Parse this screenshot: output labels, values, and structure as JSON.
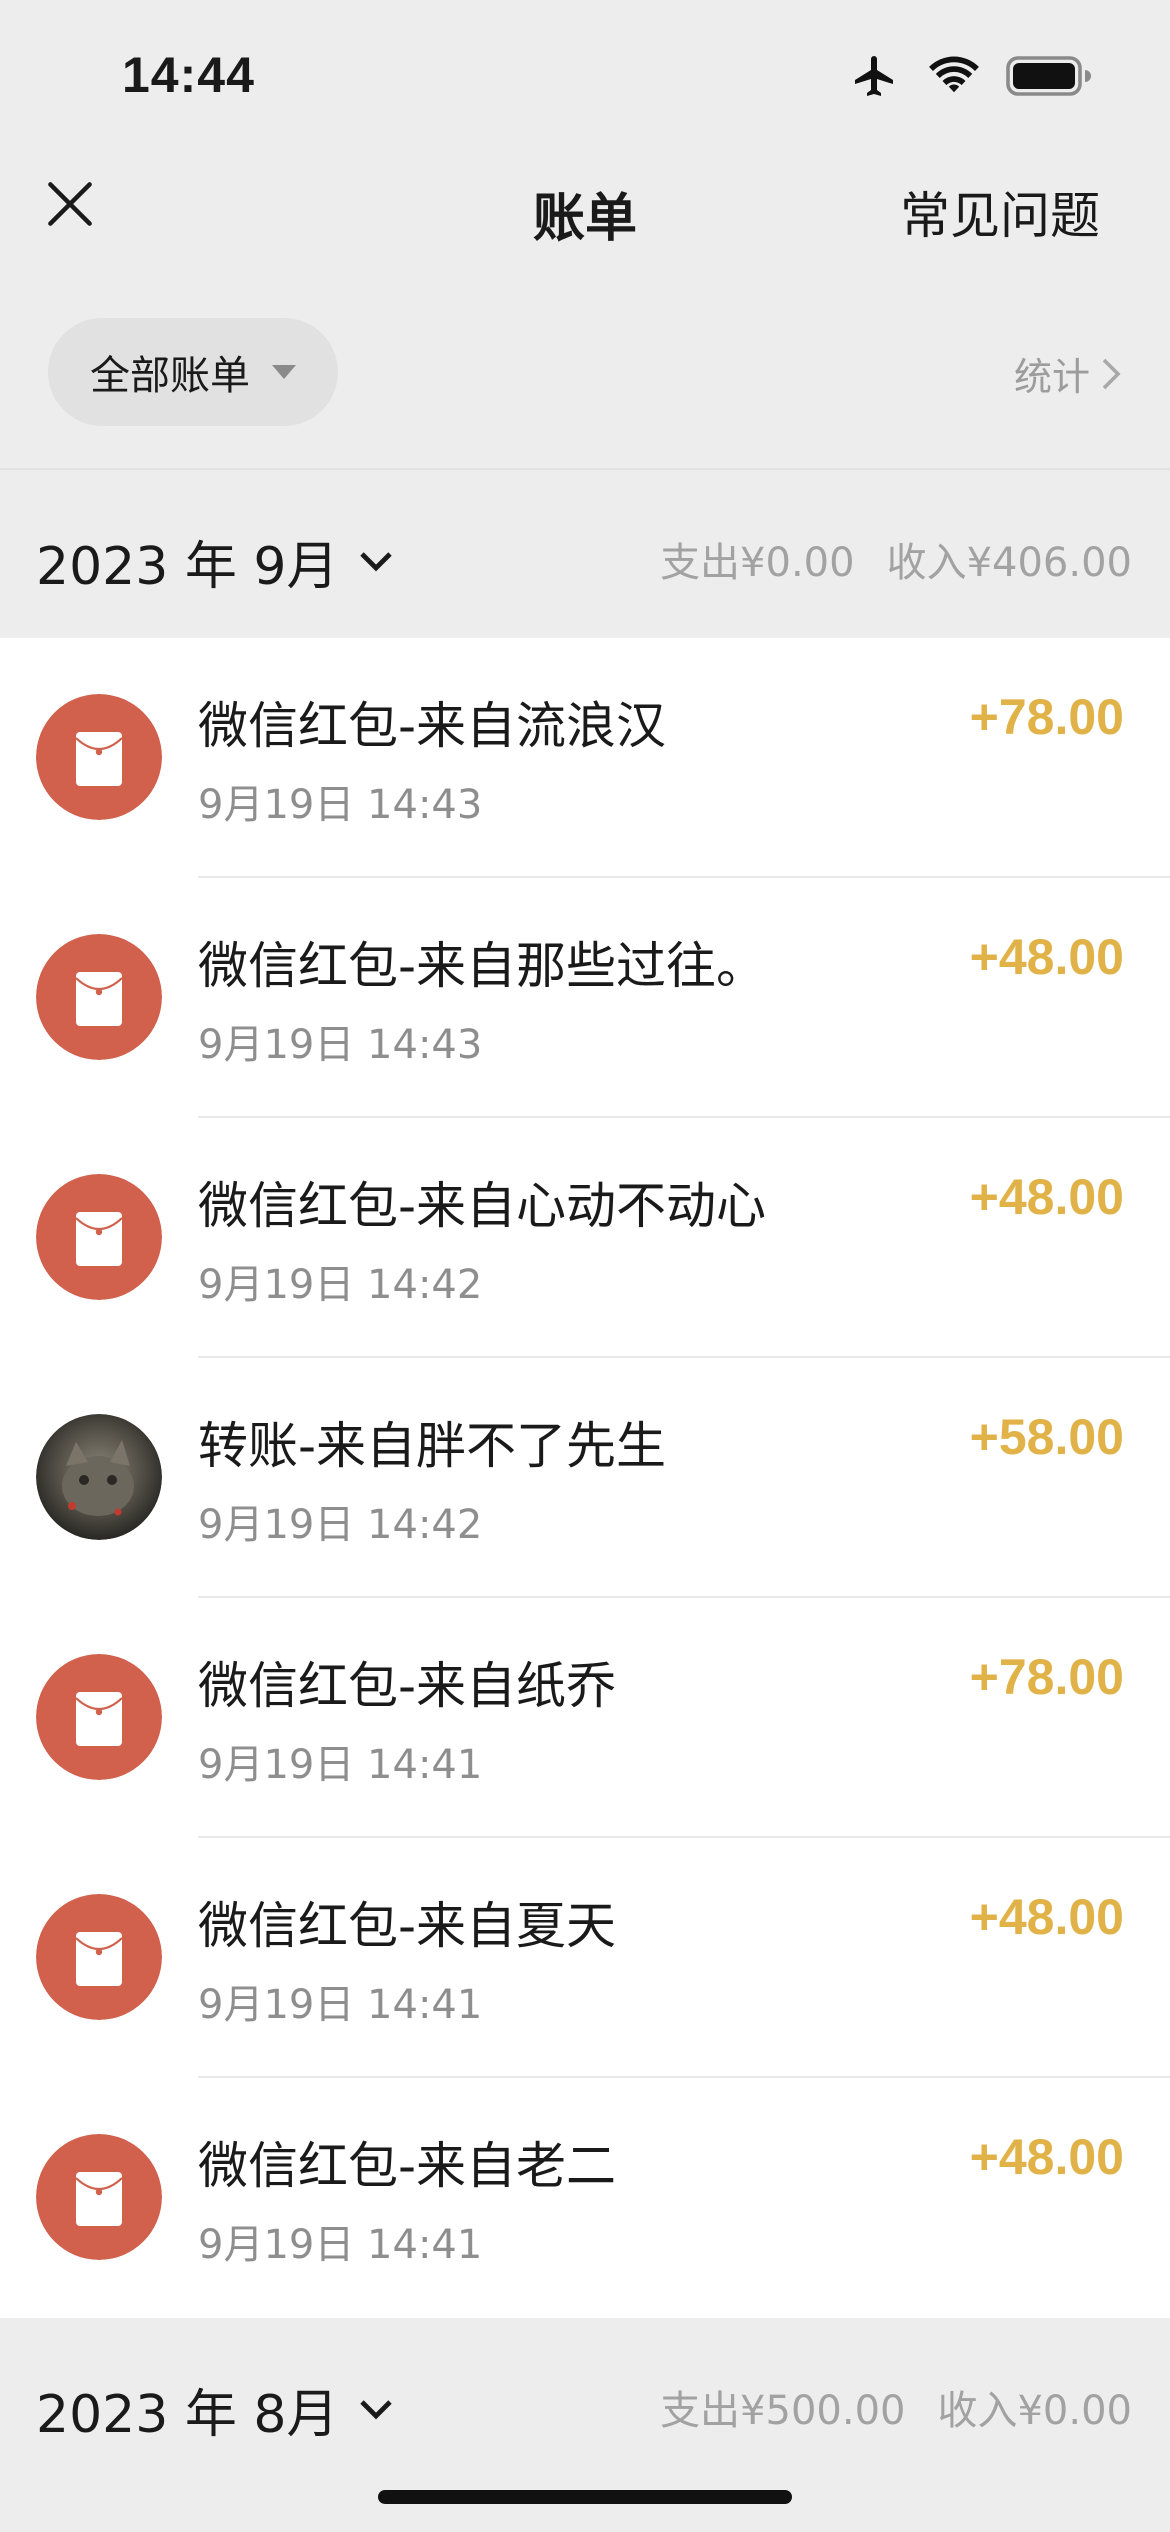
{
  "status_bar": {
    "time": "14:44"
  },
  "nav": {
    "title": "账单",
    "faq": "常见问题"
  },
  "filter": {
    "label": "全部账单",
    "stats": "统计"
  },
  "months": [
    {
      "label": "2023 年 9月",
      "expense": "支出¥0.00",
      "income": "收入¥406.00"
    },
    {
      "label": "2023 年 8月",
      "expense": "支出¥500.00",
      "income": "收入¥0.00"
    }
  ],
  "transactions": [
    {
      "title": "微信红包-来自流浪汉",
      "time": "9月19日 14:43",
      "amount": "+78.00",
      "avatar": "red-packet-icon"
    },
    {
      "title": "微信红包-来自那些过往。",
      "time": "9月19日 14:43",
      "amount": "+48.00",
      "avatar": "red-packet-icon"
    },
    {
      "title": "微信红包-来自心动不动心",
      "time": "9月19日 14:42",
      "amount": "+48.00",
      "avatar": "red-packet-icon"
    },
    {
      "title": "转账-来自胖不了先生",
      "time": "9月19日 14:42",
      "amount": "+58.00",
      "avatar": "user-photo"
    },
    {
      "title": "微信红包-来自纸乔",
      "time": "9月19日 14:41",
      "amount": "+78.00",
      "avatar": "red-packet-icon"
    },
    {
      "title": "微信红包-来自夏天",
      "time": "9月19日 14:41",
      "amount": "+48.00",
      "avatar": "red-packet-icon"
    },
    {
      "title": "微信红包-来自老二",
      "time": "9月19日 14:41",
      "amount": "+48.00",
      "avatar": "red-packet-icon"
    }
  ],
  "colors": {
    "background": "#ededed",
    "list_background": "#ffffff",
    "amount": "#e0b248",
    "red_packet": "#d1614c",
    "secondary_text": "#8e8e8e"
  }
}
